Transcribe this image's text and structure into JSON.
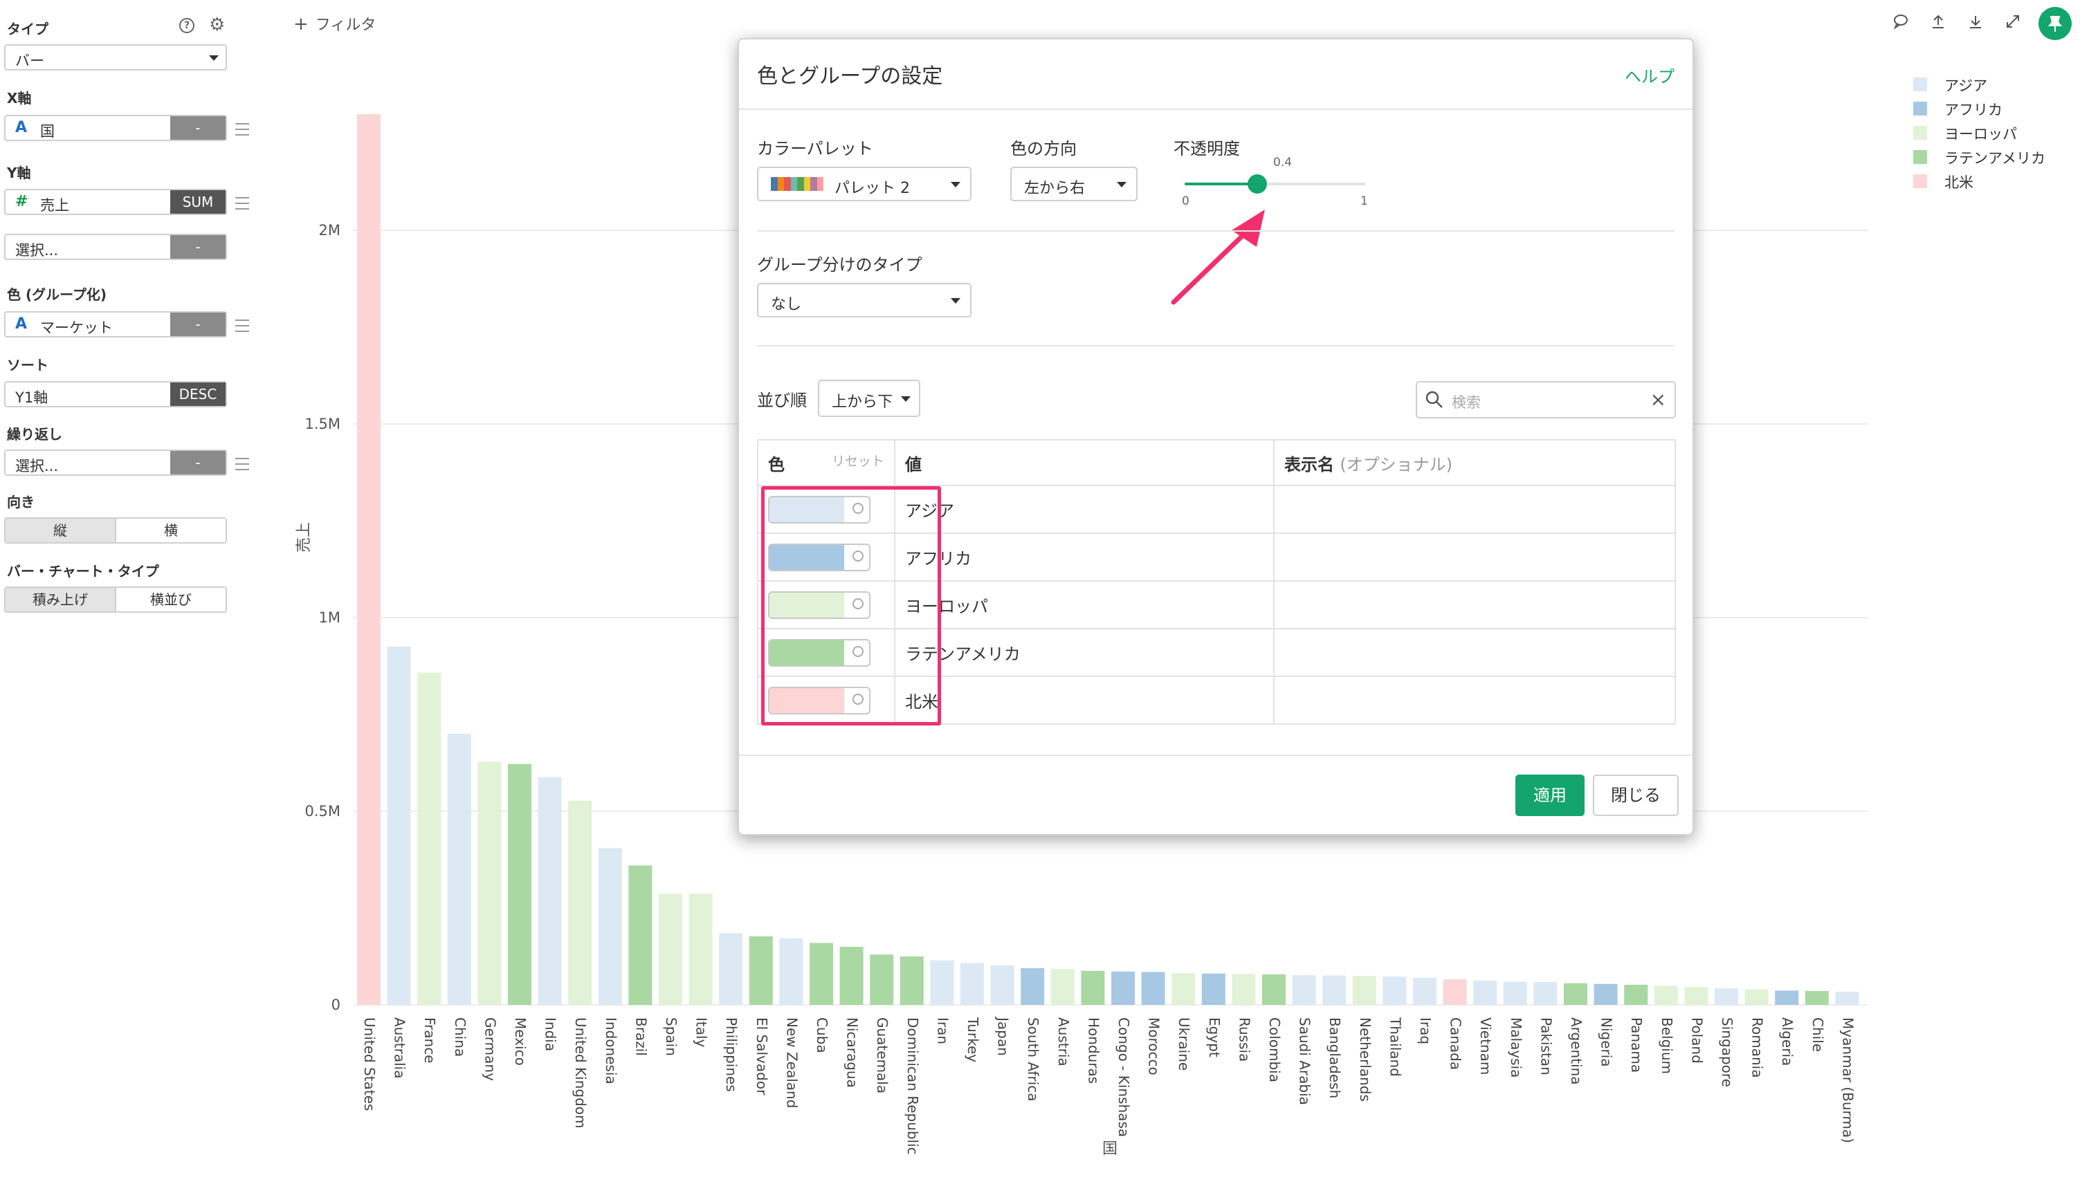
{
  "filter_label": "フィルタ",
  "left_panel": {
    "type_title": "タイプ",
    "type_value": "バー",
    "x_title": "X軸",
    "x_field": "国",
    "x_btn": "-",
    "y_title": "Y軸",
    "y_field": "売上",
    "y_agg": "SUM",
    "y_extra_placeholder": "選択...",
    "y_extra_btn": "-",
    "color_title": "色 (グループ化)",
    "color_field": "マーケット",
    "color_btn": "-",
    "sort_title": "ソート",
    "sort_field": "Y1軸",
    "sort_dir": "DESC",
    "repeat_title": "繰り返し",
    "repeat_placeholder": "選択...",
    "repeat_btn": "-",
    "orient_title": "向き",
    "orient_options": [
      "縦",
      "横"
    ],
    "bartype_title": "バー・チャート・タイプ",
    "bartype_options": [
      "積み上げ",
      "横並び"
    ]
  },
  "legend": [
    {
      "name": "アジア",
      "color": "#dce9f5"
    },
    {
      "name": "アフリカ",
      "color": "#a7c8e3"
    },
    {
      "name": "ヨーロッパ",
      "color": "#e2f2d6"
    },
    {
      "name": "ラテンアメリカ",
      "color": "#a9d8a3"
    },
    {
      "name": "北米",
      "color": "#fdd5d5"
    }
  ],
  "modal": {
    "title": "色とグループの設定",
    "help": "ヘルプ",
    "palette_label": "カラーパレット",
    "palette_value": "パレット 2",
    "direction_label": "色の方向",
    "direction_value": "左から右",
    "opacity_label": "不透明度",
    "opacity_value": "0.4",
    "opacity_min": "0",
    "opacity_max": "1",
    "grouping_label": "グループ分けのタイプ",
    "grouping_value": "なし",
    "order_label": "並び順",
    "order_value": "上から下",
    "search_placeholder": "検索",
    "col_color": "色",
    "col_reset": "リセット",
    "col_value": "値",
    "col_display": "表示名",
    "col_display_optional": "(オプショナル)",
    "rows": [
      {
        "value": "アジア",
        "color": "#dce9f5"
      },
      {
        "value": "アフリカ",
        "color": "#a7c8e3"
      },
      {
        "value": "ヨーロッパ",
        "color": "#e2f2d6"
      },
      {
        "value": "ラテンアメリカ",
        "color": "#a9d8a3"
      },
      {
        "value": "北米",
        "color": "#fdd5d5"
      }
    ],
    "apply": "適用",
    "close": "閉じる"
  },
  "chart_data": {
    "type": "bar",
    "ylabel": "売上",
    "xlabel": "国",
    "yticks": [
      "0",
      "0.5M",
      "1M",
      "1.5M",
      "2M"
    ],
    "ylim": [
      0,
      2300000
    ],
    "categories": [
      "United States",
      "Australia",
      "France",
      "China",
      "Germany",
      "Mexico",
      "India",
      "United Kingdom",
      "Indonesia",
      "Brazil",
      "Spain",
      "Italy",
      "Philippines",
      "El Salvador",
      "New Zealand",
      "Cuba",
      "Nicaragua",
      "Guatemala",
      "Dominican Republic",
      "Iran",
      "Turkey",
      "Japan",
      "South Africa",
      "Austria",
      "Honduras",
      "Congo - Kinshasa",
      "Morocco",
      "Ukraine",
      "Egypt",
      "Russia",
      "Colombia",
      "Saudi Arabia",
      "Bangladesh",
      "Netherlands",
      "Thailand",
      "Iraq",
      "Canada",
      "Vietnam",
      "Malaysia",
      "Pakistan",
      "Argentina",
      "Nigeria",
      "Panama",
      "Belgium",
      "Poland",
      "Singapore",
      "Romania",
      "Algeria",
      "Chile",
      "Myanmar (Burma)"
    ],
    "values": [
      2300000,
      925000,
      858000,
      700000,
      628000,
      622000,
      588000,
      527000,
      405000,
      360000,
      287000,
      287000,
      185000,
      177000,
      172000,
      160000,
      150000,
      130000,
      125000,
      115000,
      108000,
      102000,
      95000,
      93000,
      88000,
      86000,
      85000,
      82000,
      81000,
      80000,
      79000,
      77000,
      76000,
      75000,
      73000,
      70000,
      66000,
      63000,
      60000,
      59000,
      56000,
      54000,
      52000,
      49000,
      46000,
      43000,
      40000,
      37000,
      36000,
      34000
    ],
    "markets": [
      "北米",
      "アジア",
      "ヨーロッパ",
      "アジア",
      "ヨーロッパ",
      "ラテンアメリカ",
      "アジア",
      "ヨーロッパ",
      "アジア",
      "ラテンアメリカ",
      "ヨーロッパ",
      "ヨーロッパ",
      "アジア",
      "ラテンアメリカ",
      "アジア",
      "ラテンアメリカ",
      "ラテンアメリカ",
      "ラテンアメリカ",
      "ラテンアメリカ",
      "アジア",
      "アジア",
      "アジア",
      "アフリカ",
      "ヨーロッパ",
      "ラテンアメリカ",
      "アフリカ",
      "アフリカ",
      "ヨーロッパ",
      "アフリカ",
      "ヨーロッパ",
      "ラテンアメリカ",
      "アジア",
      "アジア",
      "ヨーロッパ",
      "アジア",
      "アジア",
      "北米",
      "アジア",
      "アジア",
      "アジア",
      "ラテンアメリカ",
      "アフリカ",
      "ラテンアメリカ",
      "ヨーロッパ",
      "ヨーロッパ",
      "アジア",
      "ヨーロッパ",
      "アフリカ",
      "ラテンアメリカ",
      "アジア"
    ]
  }
}
